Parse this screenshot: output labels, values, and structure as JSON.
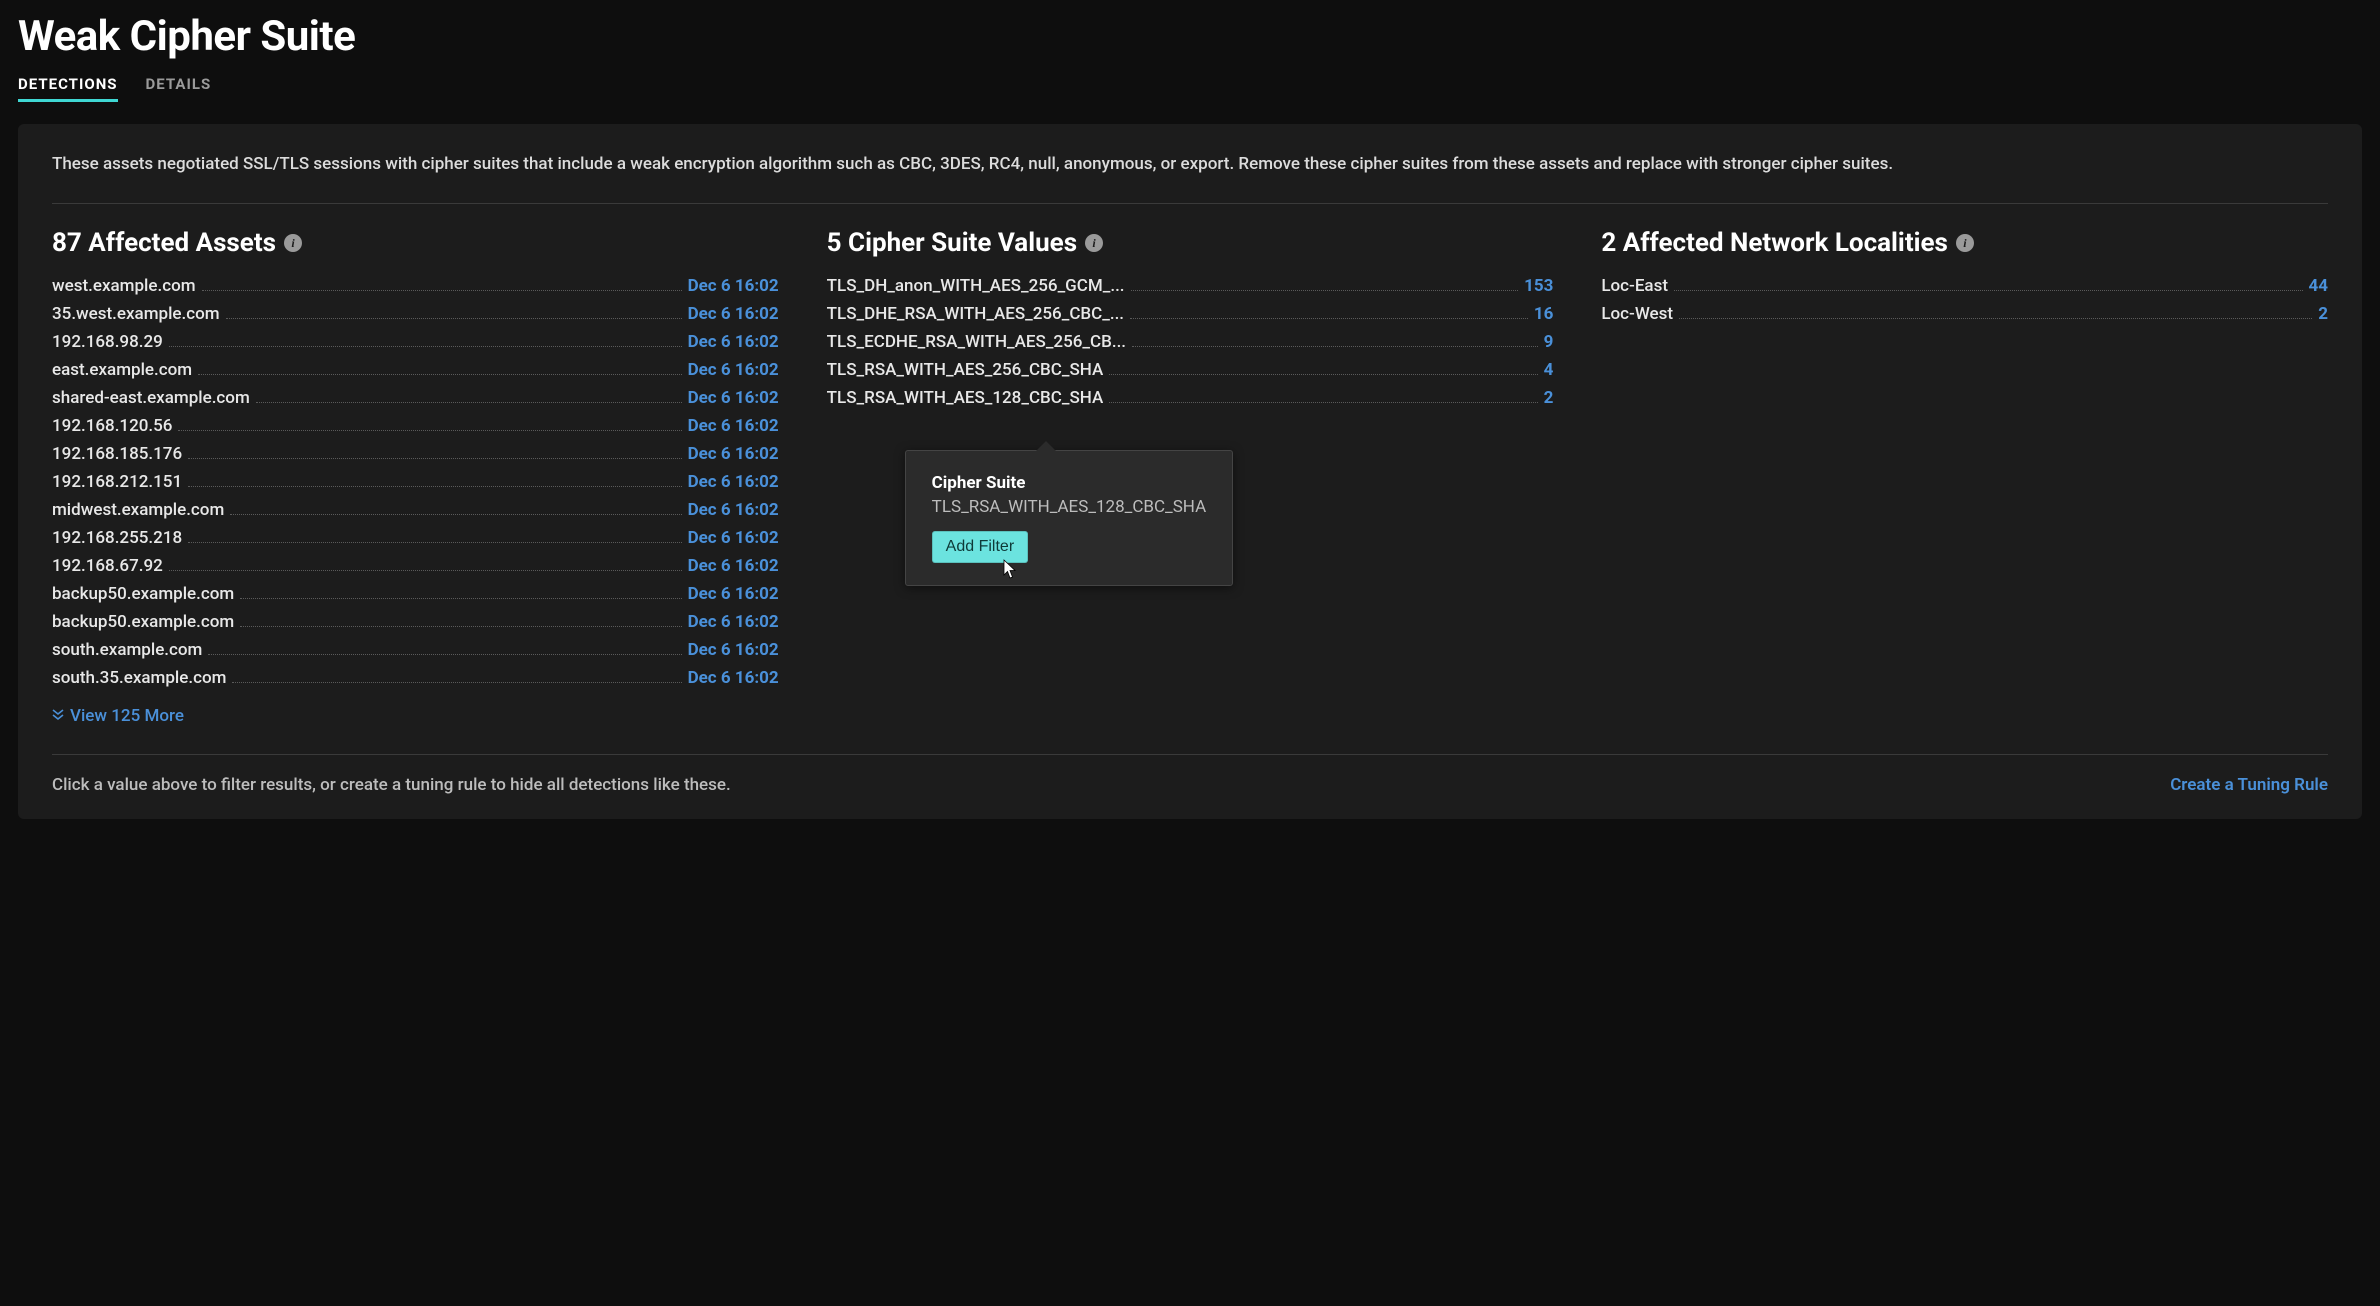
{
  "page_title": "Weak Cipher Suite",
  "tabs": [
    {
      "label": "DETECTIONS",
      "active": true
    },
    {
      "label": "DETAILS",
      "active": false
    }
  ],
  "description": "These assets negotiated SSL/TLS sessions with cipher suites that include a weak encryption algorithm such as CBC, 3DES, RC4, null, anonymous, or export. Remove these cipher suites from these assets and replace with stronger cipher suites.",
  "affected_assets": {
    "title": "87 Affected Assets",
    "items": [
      {
        "name": "west.example.com",
        "time": "Dec 6 16:02"
      },
      {
        "name": "35.west.example.com",
        "time": "Dec 6 16:02"
      },
      {
        "name": "192.168.98.29",
        "time": "Dec 6 16:02"
      },
      {
        "name": "east.example.com",
        "time": "Dec 6 16:02"
      },
      {
        "name": "shared-east.example.com",
        "time": "Dec 6 16:02"
      },
      {
        "name": "192.168.120.56",
        "time": "Dec 6 16:02"
      },
      {
        "name": "192.168.185.176",
        "time": "Dec 6 16:02"
      },
      {
        "name": "192.168.212.151",
        "time": "Dec 6 16:02"
      },
      {
        "name": "midwest.example.com",
        "time": "Dec 6 16:02"
      },
      {
        "name": "192.168.255.218",
        "time": "Dec 6 16:02"
      },
      {
        "name": "192.168.67.92",
        "time": "Dec 6 16:02"
      },
      {
        "name": "backup50.example.com",
        "time": "Dec 6 16:02"
      },
      {
        "name": "backup50.example.com",
        "time": "Dec 6 16:02"
      },
      {
        "name": "south.example.com",
        "time": "Dec 6 16:02"
      },
      {
        "name": "south.35.example.com",
        "time": "Dec 6 16:02"
      }
    ],
    "view_more": "View 125 More"
  },
  "cipher_values": {
    "title": "5 Cipher Suite Values",
    "items": [
      {
        "name": "TLS_DH_anon_WITH_AES_256_GCM_...",
        "count": "153"
      },
      {
        "name": "TLS_DHE_RSA_WITH_AES_256_CBC_...",
        "count": "16"
      },
      {
        "name": "TLS_ECDHE_RSA_WITH_AES_256_CB...",
        "count": "9"
      },
      {
        "name": "TLS_RSA_WITH_AES_256_CBC_SHA",
        "count": "4"
      },
      {
        "name": "TLS_RSA_WITH_AES_128_CBC_SHA",
        "count": "2"
      }
    ]
  },
  "localities": {
    "title": "2 Affected Network Localities",
    "items": [
      {
        "name": "Loc-East",
        "count": "44"
      },
      {
        "name": "Loc-West",
        "count": "2"
      }
    ]
  },
  "popover": {
    "title": "Cipher Suite",
    "value": "TLS_RSA_WITH_AES_128_CBC_SHA",
    "button": "Add Filter"
  },
  "footer": {
    "hint": "Click a value above to filter results, or create a tuning rule to hide all detections like these.",
    "link": "Create a Tuning Rule"
  }
}
